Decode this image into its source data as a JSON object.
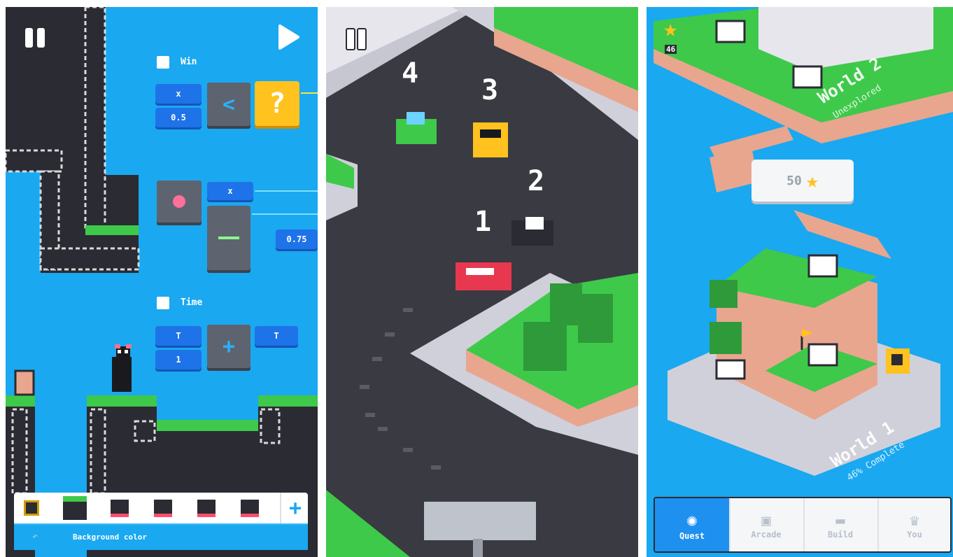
{
  "panel1": {
    "win_label": "Win",
    "time_label": "Time",
    "x_label_1": "x",
    "val_05": "0.5",
    "x_label_2": "x",
    "val_075": "0.75",
    "t_label_1": "T",
    "val_1": "1",
    "t_label_out": "T",
    "lt_symbol": "<",
    "q_symbol": "?",
    "plus_symbol": "+",
    "add_symbol": "+",
    "bottom_bar_label": "Background color"
  },
  "panel2": {
    "positions": [
      "4",
      "3",
      "2",
      "1"
    ]
  },
  "panel3": {
    "star_count": "46",
    "cost_value": "50",
    "world2_title": "World 2",
    "world2_status": "Unexplored",
    "world1_title": "World 1",
    "world1_status": "46% Complete",
    "tabs": [
      "Quest",
      "Arcade",
      "Build",
      "You"
    ]
  },
  "colors": {
    "sky_blue": "#1aa8f0",
    "grass_green": "#3ec94a",
    "dirt_pink": "#e8a68e",
    "asphalt": "#3a3a42",
    "accent_blue": "#1e73e8",
    "question_yellow": "#ffc21e"
  }
}
